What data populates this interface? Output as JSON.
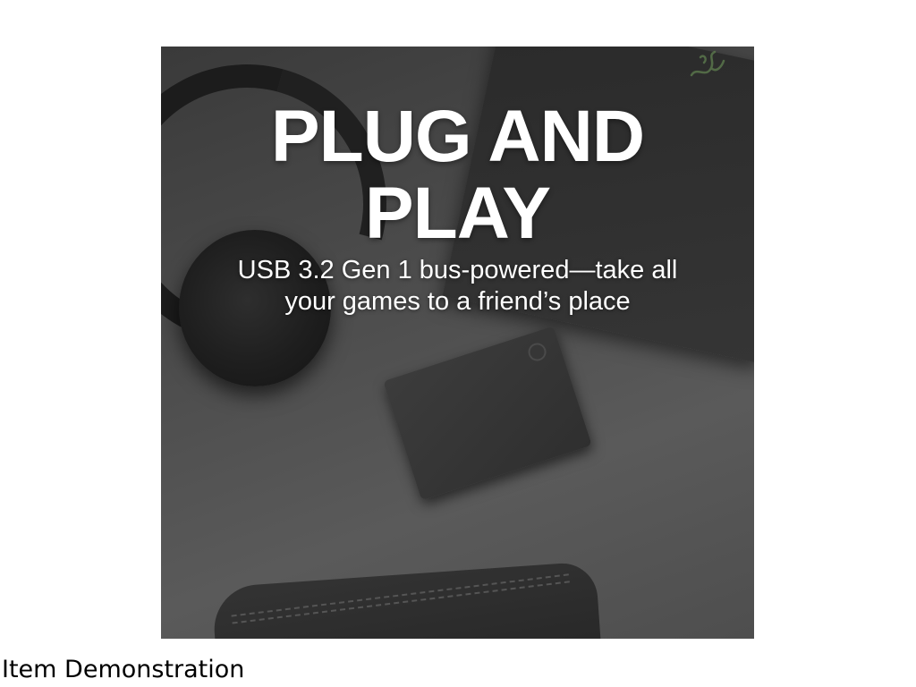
{
  "product_image": {
    "headline_line1": "PLUG AND",
    "headline_line2": "PLAY",
    "subtext_line1": "USB 3.2 Gen 1 bus-powered—take all",
    "subtext_line2": "your games to a friend’s place",
    "icons": [
      "razer-snake-logo",
      "headphones",
      "portable-drive",
      "laptop",
      "bag"
    ],
    "colors": {
      "background": "#4a4a4a",
      "text": "#ffffff",
      "logo": "#5f7f4f"
    }
  },
  "caption": {
    "label": "Item Demonstration"
  }
}
